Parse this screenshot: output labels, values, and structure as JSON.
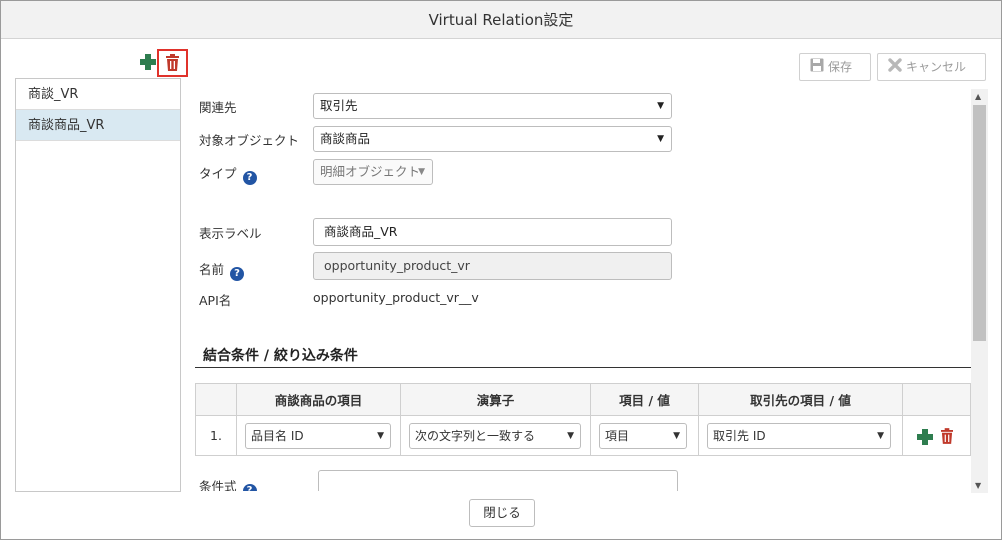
{
  "window": {
    "title": "Virtual Relation設定"
  },
  "toolbar": {
    "save_label": "保存",
    "cancel_label": "キャンセル"
  },
  "sidebar": {
    "items": [
      {
        "label": "商談_VR"
      },
      {
        "label": "商談商品_VR"
      }
    ]
  },
  "form": {
    "related_label": "関連先",
    "related_value": "取引先",
    "target_label": "対象オブジェクト",
    "target_value": "商談商品",
    "type_label": "タイプ",
    "type_value": "明細オブジェクト",
    "display_label_label": "表示ラベル",
    "display_label_value": "商談商品_VR",
    "name_label": "名前",
    "name_value": "opportunity_product_vr",
    "api_label": "API名",
    "api_value": "opportunity_product_vr__v"
  },
  "conditions": {
    "section_title": "結合条件 / 絞り込み条件",
    "headers": {
      "col1": "商談商品の項目",
      "col2": "演算子",
      "col3": "項目 / 値",
      "col4": "取引先の項目 / 値"
    },
    "rows": [
      {
        "num": "1.",
        "field": "品目名 ID",
        "operator": "次の文字列と一致する",
        "kind": "項目",
        "target": "取引先 ID"
      }
    ],
    "formula_label": "条件式"
  },
  "footer": {
    "close_label": "閉じる"
  },
  "colors": {
    "accent_green": "#2e7d4f",
    "delete_red": "#c0392b",
    "selection_bg": "#d9e9f2",
    "help_blue": "#2255a4"
  }
}
